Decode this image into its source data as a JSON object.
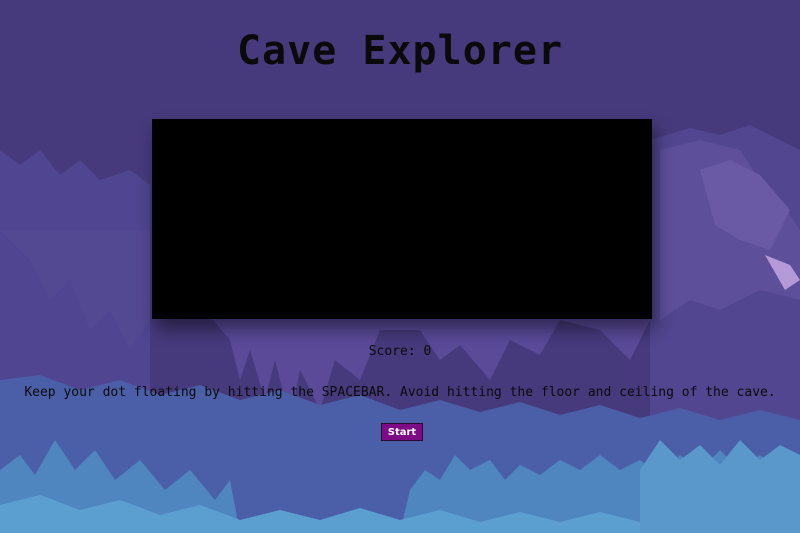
{
  "title": "Cave Explorer",
  "score": {
    "label": "Score:",
    "value": "0"
  },
  "instructions": "Keep your dot floating by hitting the SPACEBAR. Avoid hitting the floor and ceiling of the cave.",
  "start_button": {
    "label": "Start"
  },
  "colors": {
    "background": "#463a7c",
    "canvas": "#000000",
    "button": "#7e0a86",
    "text": "#0a0a0a"
  }
}
